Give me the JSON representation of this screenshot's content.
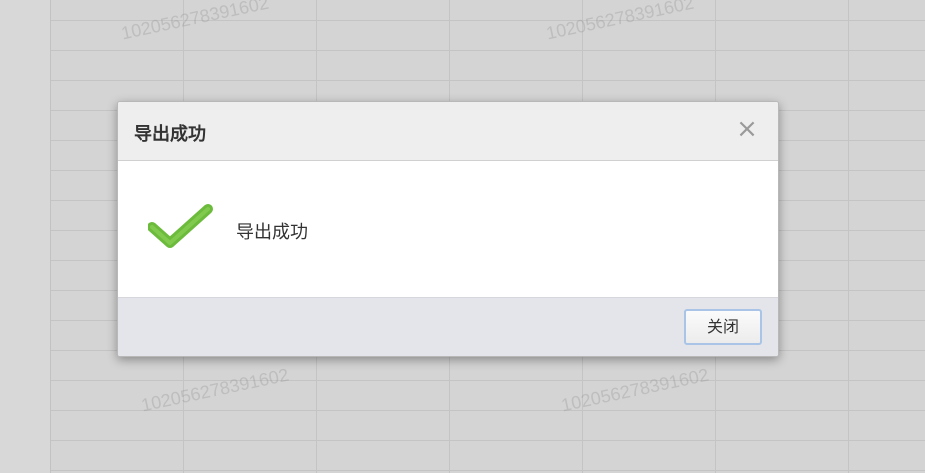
{
  "dialog": {
    "title": "导出成功",
    "close_icon": "close-icon",
    "message": "导出成功",
    "status_icon": "checkmark-icon",
    "close_button_label": "关闭"
  },
  "watermark": {
    "text": "102056278391602"
  },
  "colors": {
    "check_green": "#6cbb3c",
    "button_border": "#a9c4e6",
    "footer_bg": "#e4e5ea",
    "header_bg": "#eeeeee"
  }
}
